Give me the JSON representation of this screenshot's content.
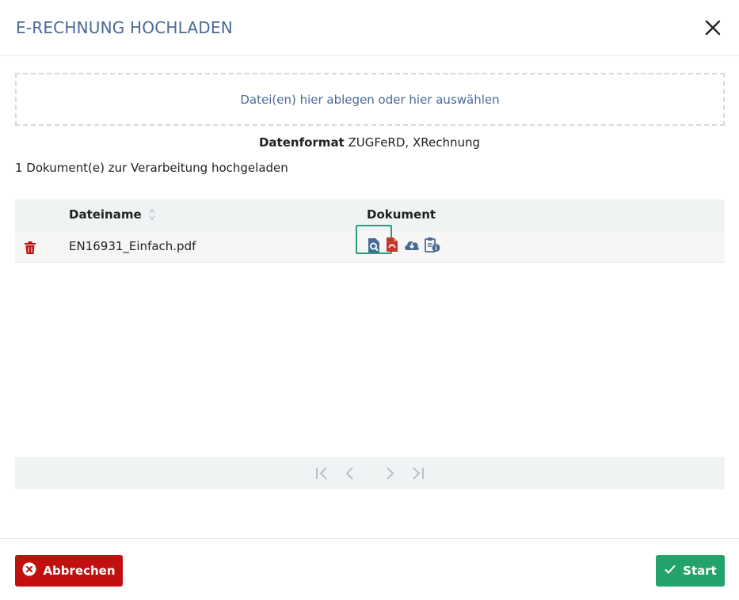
{
  "dialog": {
    "title": "E-RECHNUNG HOCHLADEN"
  },
  "dropzone": {
    "label": "Datei(en) hier ablegen oder hier auswählen"
  },
  "format": {
    "label": "Datenformat",
    "value": "ZUGFeRD, XRechnung"
  },
  "upload_count": "1 Dokument(e) zur Verarbeitung hochgeladen",
  "table": {
    "columns": [
      "Dateiname",
      "Dokument"
    ],
    "rows": [
      {
        "filename": "EN16931_Einfach.pdf",
        "actions": [
          "preview-icon",
          "pdf-icon",
          "download-icon",
          "clipboard-info-icon"
        ]
      }
    ]
  },
  "pagination": {
    "buttons": [
      "first-page-icon",
      "previous-page-icon",
      "next-page-icon",
      "last-page-icon"
    ]
  },
  "footer": {
    "cancel_label": "Abbrechen",
    "start_label": "Start"
  },
  "colors": {
    "title": "#4a6a96",
    "cancel": "#c20f0f",
    "start": "#22a36a",
    "highlight": "#2a9d7f",
    "icon": "#4a6a96",
    "pdf": "#c0392b"
  }
}
